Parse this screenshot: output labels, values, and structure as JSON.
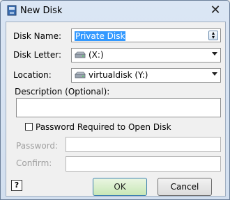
{
  "window": {
    "title": "New Disk",
    "close_glyph": "✕",
    "icon": "disk-app-icon"
  },
  "form": {
    "disk_name": {
      "label": "Disk Name:",
      "value": "Private Disk"
    },
    "disk_letter": {
      "label": "Disk Letter:",
      "value": "(X:)",
      "icon": "drive-icon"
    },
    "location": {
      "label": "Location:",
      "value": "virtualdisk (Y:)",
      "icon": "drive-icon"
    },
    "description": {
      "label": "Description (Optional):",
      "value": ""
    },
    "password_required": {
      "label": "Password Required to Open Disk",
      "checked": false
    },
    "password": {
      "label": "Password:",
      "value": ""
    },
    "confirm": {
      "label": "Confirm:",
      "value": ""
    }
  },
  "buttons": {
    "help": "?",
    "ok": "OK",
    "cancel": "Cancel"
  },
  "colors": {
    "title_gradient": "#dbe6f4",
    "selection": "#3399ff",
    "ok_button": "#c8e7b6"
  }
}
